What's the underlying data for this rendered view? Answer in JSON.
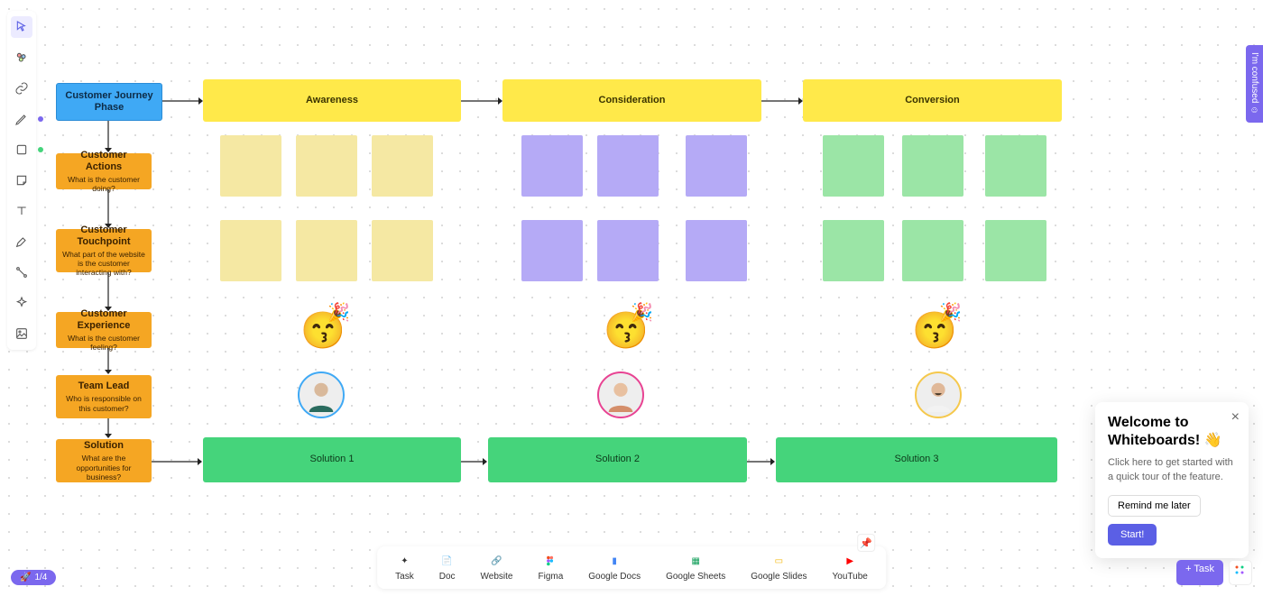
{
  "toolbar": {
    "items": [
      {
        "name": "cursor",
        "active": true
      },
      {
        "name": "ai"
      },
      {
        "name": "link"
      },
      {
        "name": "pen",
        "dot": "#7b68ee"
      },
      {
        "name": "shape",
        "dot": "#45d47b"
      },
      {
        "name": "sticky"
      },
      {
        "name": "text"
      },
      {
        "name": "highlighter"
      },
      {
        "name": "connector"
      },
      {
        "name": "sparkle"
      },
      {
        "name": "image"
      }
    ]
  },
  "diagram": {
    "header": {
      "title": "Customer Journey Phase"
    },
    "phases": [
      {
        "label": "Awareness",
        "sticky_color": "y"
      },
      {
        "label": "Consideration",
        "sticky_color": "p"
      },
      {
        "label": "Conversion",
        "sticky_color": "g"
      }
    ],
    "rows": [
      {
        "title": "Customer Actions",
        "subtitle": "What is the customer doing?"
      },
      {
        "title": "Customer Touchpoint",
        "subtitle": "What part of the website is the customer interacting with?"
      },
      {
        "title": "Customer Experience",
        "subtitle": "What is the customer feeling?"
      },
      {
        "title": "Team Lead",
        "subtitle": "Who is responsible on this customer?"
      },
      {
        "title": "Solution",
        "subtitle": "What are the opportunities for business?"
      }
    ],
    "solutions": [
      "Solution 1",
      "Solution 2",
      "Solution 3"
    ]
  },
  "confused_tab": "I'm confused",
  "popover": {
    "title": "Welcome to Whiteboards! 👋",
    "desc": "Click here to get started with a quick tour of the feature.",
    "remind": "Remind me later",
    "start": "Start!"
  },
  "insert_bar": [
    {
      "name": "task",
      "label": "Task"
    },
    {
      "name": "doc",
      "label": "Doc"
    },
    {
      "name": "website",
      "label": "Website"
    },
    {
      "name": "figma",
      "label": "Figma"
    },
    {
      "name": "googledocs",
      "label": "Google Docs"
    },
    {
      "name": "googlesheets",
      "label": "Google Sheets"
    },
    {
      "name": "googleslides",
      "label": "Google Slides"
    },
    {
      "name": "youtube",
      "label": "YouTube"
    }
  ],
  "nav_pill": "1/4",
  "task_btn": "+ Task"
}
